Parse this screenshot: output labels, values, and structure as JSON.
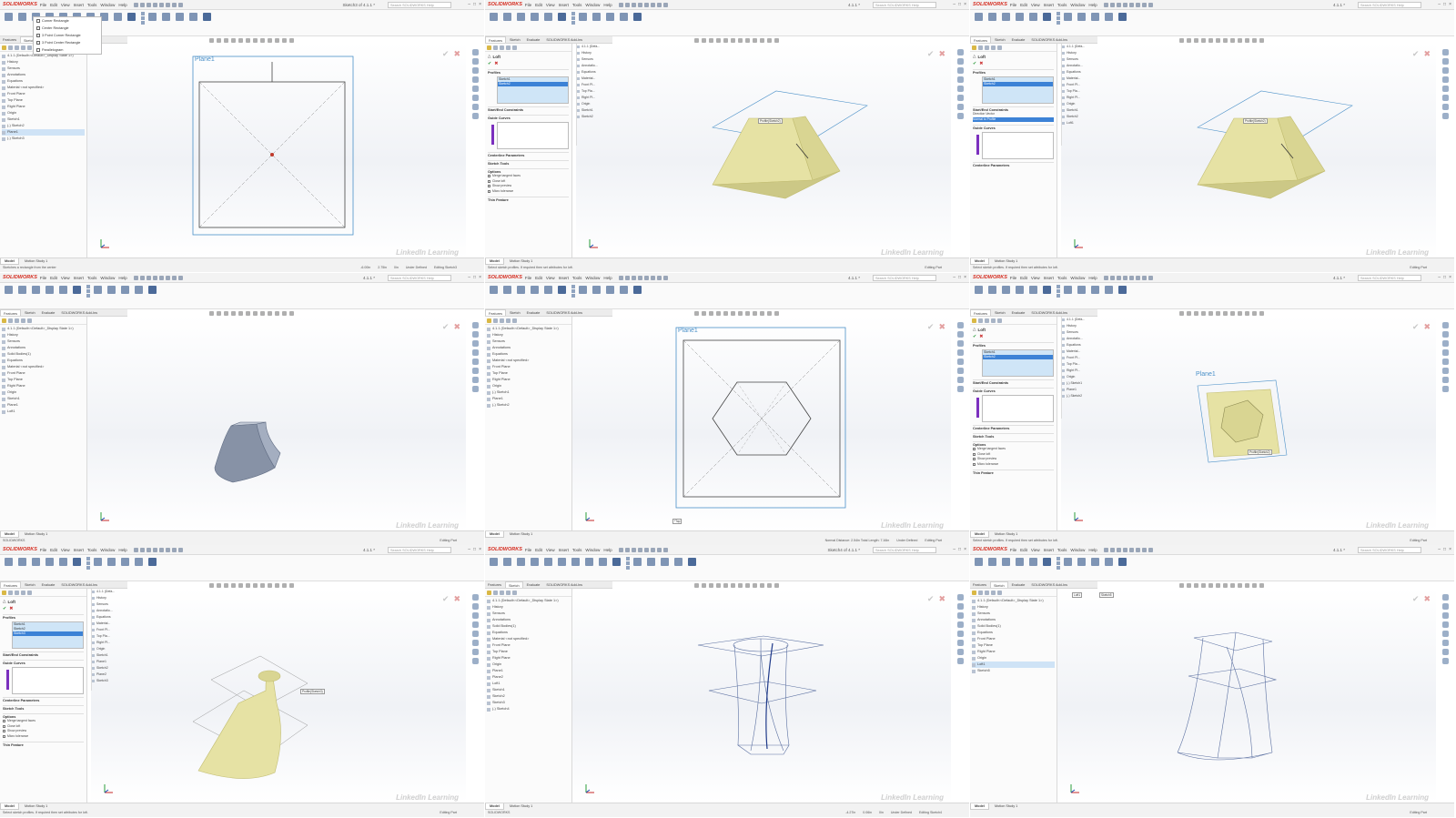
{
  "app": {
    "name": "SOLIDWORKS",
    "menu": [
      "File",
      "Edit",
      "View",
      "Insert",
      "Tools",
      "Window",
      "Help"
    ],
    "search_placeholder": "Search SOLIDWORKS Help",
    "watermark": "LinkedIn Learning"
  },
  "panels": [
    {
      "title": "Sketch3 of 4.1.1 *",
      "mode": "sketch",
      "tabs": [
        "Features",
        "Sketch",
        "Evaluate",
        "SOLIDWORKS Add-Ins"
      ],
      "selected_tab": "Sketch",
      "rectangle_menu": [
        "Corner Rectangle",
        "Center Rectangle",
        "3 Point Corner Rectangle",
        "3 Point Center Rectangle",
        "Parallelogram"
      ],
      "tree": [
        "4.1.1 (Default<<Default>_Display State 1>)",
        "History",
        "Sensors",
        "Annotations",
        "Equations",
        "Material <not specified>",
        "Front Plane",
        "Top Plane",
        "Right Plane",
        "Origin",
        "Sketch1",
        "(-) Sketch2",
        "Plane1",
        "(-) Sketch3"
      ],
      "plane_label": "Plane1",
      "status_left": "Sketches a rectangle from the center",
      "status_values": [
        "-6.00in",
        "2.75in",
        "0in",
        "Under Defined",
        "Editing Sketch3"
      ],
      "bottom_tabs": [
        "Model",
        "Motion Study 1"
      ]
    },
    {
      "title": "4.1.1 *",
      "mode": "loft",
      "tabs": [
        "Features",
        "Sketch",
        "Evaluate",
        "SOLIDWORKS Add-Ins"
      ],
      "selected_tab": "Features",
      "pm_title": "Loft",
      "profiles": [
        "Sketch1",
        "Sketch2"
      ],
      "sections": [
        "Profiles",
        "Start/End Constraints",
        "Guide Curves",
        "Centerline Parameters",
        "Sketch Tools",
        "Options",
        "Thin Feature"
      ],
      "options": [
        "Merge tangent faces",
        "Close loft",
        "Show preview",
        "Micro tolerance"
      ],
      "flyout": [
        "4.1.1 (Defa...",
        "History",
        "Sensors",
        "Annotatio...",
        "Equations",
        "Material...",
        "Front Pl...",
        "Top Pla...",
        "Right Pl...",
        "Origin",
        "Sketch1",
        "Sketch2"
      ],
      "label_3d": "Profile(Sketch2)",
      "status_left": "Select sketch profiles. If required then set attributes for loft.",
      "status_values": [
        "Editing Part"
      ],
      "bottom_tabs": [
        "Model",
        "Motion Study 1"
      ]
    },
    {
      "title": "4.1.1 *",
      "mode": "loft-constraints",
      "tabs": [
        "Features",
        "Sketch",
        "Evaluate",
        "SOLIDWORKS Add-Ins"
      ],
      "selected_tab": "Features",
      "pm_title": "Loft",
      "profiles": [
        "Sketch1",
        "Sketch2"
      ],
      "start_constraint": "Direction Vector",
      "end_constraint": "Normal to Profile",
      "sections": [
        "Profiles",
        "Start/End Constraints",
        "Guide Curves",
        "Centerline Parameters"
      ],
      "flyout": [
        "4.1.1 (Defa...",
        "History",
        "Sensors",
        "Annotatio...",
        "Equations",
        "Material...",
        "Front Pl...",
        "Top Pla...",
        "Right Pl...",
        "Origin",
        "Sketch1",
        "Sketch2",
        "Loft1"
      ],
      "label_3d": "Profile(Sketch2)",
      "status_left": "Select sketch profiles. If required then set attributes for loft.",
      "status_values": [
        "Editing Part"
      ],
      "bottom_tabs": [
        "Model",
        "Motion Study 1"
      ]
    },
    {
      "title": "4.1.1 *",
      "mode": "solid",
      "tabs": [
        "Features",
        "Sketch",
        "Evaluate",
        "SOLIDWORKS Add-Ins"
      ],
      "selected_tab": "Features",
      "tree": [
        "4.1.1 (Default<<Default>_Display State 1>)",
        "History",
        "Sensors",
        "Annotations",
        "Solid Bodies(1)",
        "Equations",
        "Material <not specified>",
        "Front Plane",
        "Top Plane",
        "Right Plane",
        "Origin",
        "Sketch1",
        "Plane1",
        "Loft1"
      ],
      "status_left": "SOLIDWORKS",
      "status_values": [
        "Editing Part"
      ],
      "bottom_tabs": [
        "Model",
        "Motion Study 1"
      ]
    },
    {
      "title": "4.1.1 *",
      "mode": "hexagon",
      "tabs": [
        "Features",
        "Sketch",
        "Evaluate",
        "SOLIDWORKS Add-Ins"
      ],
      "selected_tab": "Features",
      "tree": [
        "4.1.1 (Default<<Default>_Display State 1>)",
        "History",
        "Sensors",
        "Annotations",
        "Equations",
        "Material <not specified>",
        "Front Plane",
        "Top Plane",
        "Right Plane",
        "Origin",
        "(-) Sketch1",
        "Plane1",
        "(-) Sketch2"
      ],
      "plane_label": "Plane1",
      "view_label": "*Top",
      "status_left": "",
      "status_values": [
        "Normal Distance: 2.54in Total Length: 7.16in",
        "Under Defined",
        "Editing Part"
      ],
      "bottom_tabs": [
        "Model",
        "Motion Study 1"
      ]
    },
    {
      "title": "4.1.1 *",
      "mode": "loft-hex",
      "tabs": [
        "Features",
        "Sketch",
        "Evaluate",
        "SOLIDWORKS Add-Ins"
      ],
      "selected_tab": "Features",
      "pm_title": "Loft",
      "profiles": [
        "Sketch1",
        "Sketch2"
      ],
      "sections": [
        "Profiles",
        "Start/End Constraints",
        "Guide Curves",
        "Centerline Parameters",
        "Sketch Tools",
        "Options",
        "Thin Feature"
      ],
      "options": [
        "Merge tangent faces",
        "Close loft",
        "Show preview",
        "Micro tolerance"
      ],
      "flyout": [
        "4.1.1 (Defa...",
        "History",
        "Sensors",
        "Annotatio...",
        "Equations",
        "Material...",
        "Front Pl...",
        "Top Pla...",
        "Right Pl...",
        "Origin",
        "(-) Sketch1",
        "Plane1",
        "(-) Sketch2"
      ],
      "plane_label": "Plane1",
      "label_3d": "Profile(Sketch2)",
      "status_left": "Select sketch profiles. If required then set attributes for loft.",
      "status_values": [
        "Editing Part"
      ],
      "bottom_tabs": [
        "Model",
        "Motion Study 1"
      ]
    },
    {
      "title": "4.1.1 *",
      "mode": "loft-vase",
      "tabs": [
        "Features",
        "Sketch",
        "Evaluate",
        "SOLIDWORKS Add-Ins"
      ],
      "selected_tab": "Features",
      "pm_title": "Loft",
      "profiles": [
        "Sketch1",
        "Sketch2",
        "Sketch3"
      ],
      "sections": [
        "Profiles",
        "Start/End Constraints",
        "Guide Curves",
        "Centerline Parameters",
        "Sketch Tools",
        "Options",
        "Thin Feature"
      ],
      "options": [
        "Merge tangent faces",
        "Close loft",
        "Show preview",
        "Micro tolerance"
      ],
      "flyout": [
        "4.1.1 (Defa...",
        "History",
        "Sensors",
        "Annotatio...",
        "Equations",
        "Material...",
        "Front Pl...",
        "Top Pla...",
        "Right Pl...",
        "Origin",
        "Sketch1",
        "Plane1",
        "Sketch2",
        "Plane2",
        "Sketch3"
      ],
      "label_3d": "Profile(Sketch3)",
      "status_left": "Select sketch profiles. If required then set attributes for loft.",
      "status_values": [
        "Editing Part"
      ],
      "bottom_tabs": [
        "Model",
        "Motion Study 1"
      ]
    },
    {
      "title": "Sketch4 of 4.1.1 *",
      "mode": "wire",
      "tabs": [
        "Features",
        "Sketch",
        "Evaluate",
        "SOLIDWORKS Add-Ins"
      ],
      "selected_tab": "Sketch",
      "tree": [
        "4.1.1 (Default<<Default>_Display State 1>)",
        "History",
        "Sensors",
        "Annotations",
        "Solid Bodies(1)",
        "Equations",
        "Material <not specified>",
        "Front Plane",
        "Top Plane",
        "Right Plane",
        "Origin",
        "Plane1",
        "Plane2",
        "Loft1",
        "Sketch1",
        "Sketch2",
        "Sketch3",
        "(-) Sketch4"
      ],
      "status_left": "SOLIDWORKS",
      "status_values": [
        "-4.27in",
        "0.06in",
        "0in",
        "Under Defined",
        "Editing Sketch4"
      ],
      "bottom_tabs": [
        "Model",
        "Motion Study 1"
      ]
    },
    {
      "title": "4.1.1 *",
      "mode": "wire2",
      "tabs": [
        "Features",
        "Sketch",
        "Evaluate",
        "SOLIDWORKS Add-Ins"
      ],
      "selected_tab": "Sketch",
      "tree": [
        "4.1.1 (Default<<Default>_Display State 1>)",
        "History",
        "Sensors",
        "Annotations",
        "Solid Bodies(1)",
        "Equations",
        "Front Plane",
        "Top Plane",
        "Right Plane",
        "Origin",
        "Loft1",
        "Sketch5"
      ],
      "breadcrumb": [
        "Loft1",
        "Sketch5"
      ],
      "status_left": "",
      "status_values": [
        "Editing Part"
      ],
      "bottom_tabs": [
        "Model",
        "Motion Study 1"
      ]
    }
  ]
}
